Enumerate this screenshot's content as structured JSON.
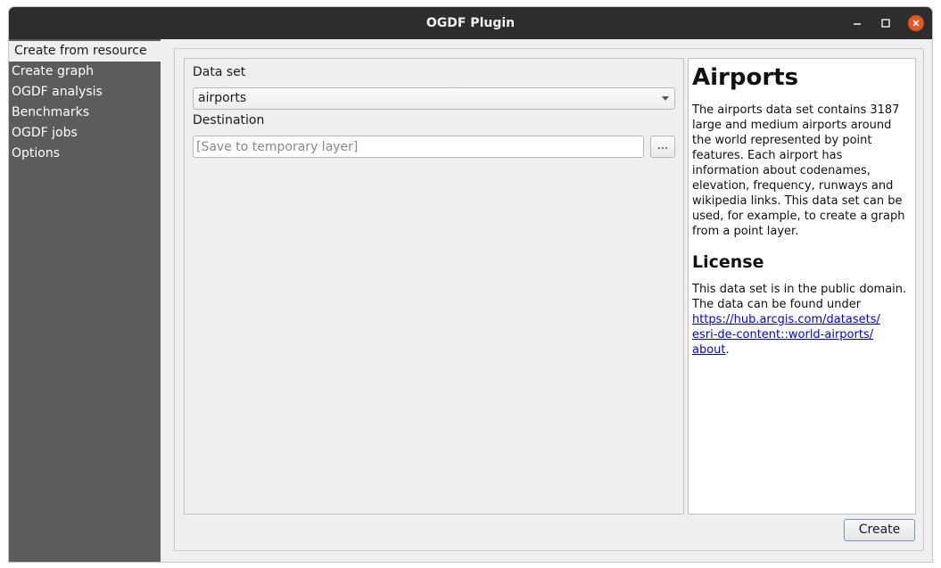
{
  "window": {
    "title": "OGDF Plugin",
    "controls": [
      "minimize-icon",
      "maximize-icon",
      "close-icon"
    ],
    "accent_color": "#e95420"
  },
  "sidebar": {
    "items": [
      {
        "label": "Create from resource",
        "active": true
      },
      {
        "label": "Create graph",
        "active": false
      },
      {
        "label": "OGDF analysis",
        "active": false
      },
      {
        "label": "Benchmarks",
        "active": false
      },
      {
        "label": "OGDF jobs",
        "active": false
      },
      {
        "label": "Options",
        "active": false
      }
    ]
  },
  "form": {
    "dataset_label": "Data set",
    "dataset_value": "airports",
    "destination_label": "Destination",
    "destination_placeholder": "[Save to temporary layer]",
    "browse_label": "..."
  },
  "description": {
    "title": "Airports",
    "body": "The airports data set contains 3187 large and medium airports around the world represented by point features. Each airport has information about codenames, elevation, frequency, runways and wikipedia links. This data set can be used, for example, to create a graph from a point layer.",
    "license_heading": "License",
    "license_text": "This data set is in the public domain. The data can be found under",
    "license_link_1": "https://hub.arcgis.com/datasets/",
    "license_link_2": "esri-de-content::world-airports/",
    "license_link_3": "about",
    "license_end": "."
  },
  "actions": {
    "create_label": "Create"
  }
}
